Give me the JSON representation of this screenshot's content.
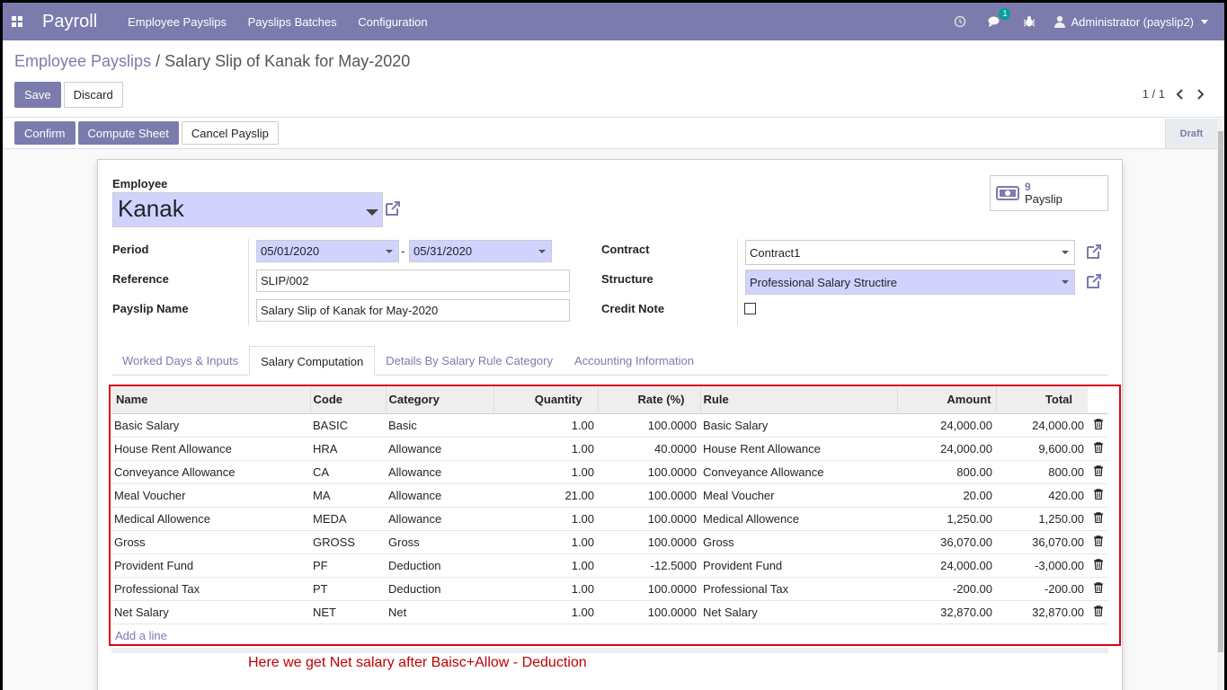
{
  "topbar": {
    "app": "Payroll",
    "menu": [
      "Employee Payslips",
      "Payslips Batches",
      "Configuration"
    ],
    "chat_badge": "1",
    "user": "Administrator (payslip2)"
  },
  "breadcrumb": {
    "parent": "Employee Payslips",
    "separator": "/",
    "current": "Salary Slip of Kanak for May-2020"
  },
  "buttons": {
    "save": "Save",
    "discard": "Discard",
    "confirm": "Confirm",
    "compute": "Compute Sheet",
    "cancel": "Cancel Payslip"
  },
  "pager": "1 / 1",
  "status": "Draft",
  "payslip_stat": {
    "count": "9",
    "label": "Payslip"
  },
  "form": {
    "employee_label": "Employee",
    "employee": "Kanak",
    "period_label": "Period",
    "date_from": "05/01/2020",
    "date_sep": "-",
    "date_to": "05/31/2020",
    "reference_label": "Reference",
    "reference": "SLIP/002",
    "name_label": "Payslip Name",
    "name": "Salary Slip of Kanak for May-2020",
    "contract_label": "Contract",
    "contract": "Contract1",
    "structure_label": "Structure",
    "structure": "Professional Salary Structire",
    "credit_label": "Credit Note"
  },
  "tabs": [
    "Worked Days & Inputs",
    "Salary Computation",
    "Details By Salary Rule Category",
    "Accounting Information"
  ],
  "table": {
    "headers": [
      "Name",
      "Code",
      "Category",
      "Quantity",
      "Rate (%)",
      "Rule",
      "Amount",
      "Total"
    ],
    "rows": [
      [
        "Basic Salary",
        "BASIC",
        "Basic",
        "1.00",
        "100.0000",
        "Basic Salary",
        "24,000.00",
        "24,000.00"
      ],
      [
        "House Rent Allowance",
        "HRA",
        "Allowance",
        "1.00",
        "40.0000",
        "House Rent Allowance",
        "24,000.00",
        "9,600.00"
      ],
      [
        "Conveyance Allowance",
        "CA",
        "Allowance",
        "1.00",
        "100.0000",
        "Conveyance Allowance",
        "800.00",
        "800.00"
      ],
      [
        "Meal Voucher",
        "MA",
        "Allowance",
        "21.00",
        "100.0000",
        "Meal Voucher",
        "20.00",
        "420.00"
      ],
      [
        "Medical Allowence",
        "MEDA",
        "Allowance",
        "1.00",
        "100.0000",
        "Medical Allowence",
        "1,250.00",
        "1,250.00"
      ],
      [
        "Gross",
        "GROSS",
        "Gross",
        "1.00",
        "100.0000",
        "Gross",
        "36,070.00",
        "36,070.00"
      ],
      [
        "Provident Fund",
        "PF",
        "Deduction",
        "1.00",
        "-12.5000",
        "Provident Fund",
        "24,000.00",
        "-3,000.00"
      ],
      [
        "Professional Tax",
        "PT",
        "Deduction",
        "1.00",
        "100.0000",
        "Professional Tax",
        "-200.00",
        "-200.00"
      ],
      [
        "Net Salary",
        "NET",
        "Net",
        "1.00",
        "100.0000",
        "Net Salary",
        "32,870.00",
        "32,870.00"
      ]
    ],
    "add_line": "Add a line"
  },
  "annotation": "Here we get Net salary after Baisc+Allow - Deduction"
}
